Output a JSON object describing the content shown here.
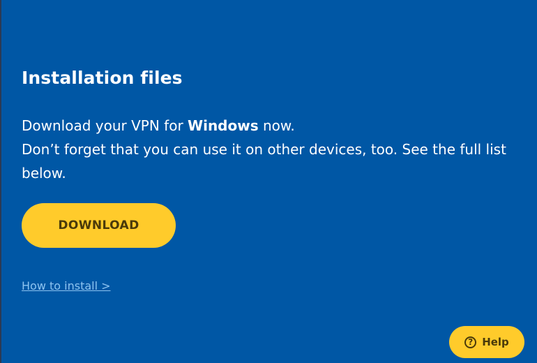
{
  "header": {
    "title": "Installation files"
  },
  "description": {
    "line1_prefix": "Download your VPN for ",
    "platform": "Windows",
    "line1_suffix": " now.",
    "line2": "Don’t forget that you can use it on other devices, too. See the full list below."
  },
  "actions": {
    "download_label": "DOWNLOAD",
    "install_link_label": "How to install >"
  },
  "help_widget": {
    "icon": "question-circle-icon",
    "icon_glyph": "?",
    "label": "Help"
  },
  "colors": {
    "background": "#0057a5",
    "accent": "#ffcb2b",
    "link": "#8ec3f0"
  }
}
